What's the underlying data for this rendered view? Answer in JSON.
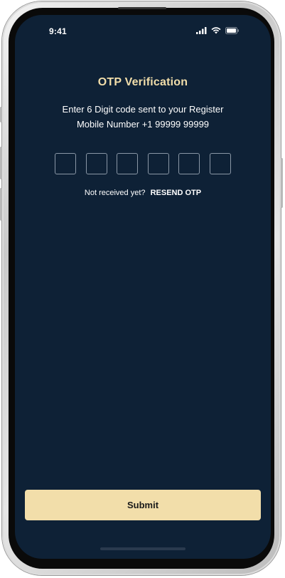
{
  "status_bar": {
    "time": "9:41",
    "icons": [
      "signal-icon",
      "wifi-icon",
      "battery-icon"
    ]
  },
  "otp": {
    "title": "OTP Verification",
    "instruction_line1": "Enter 6 Digit code sent to your Register",
    "instruction_line2": "Mobile Number +1 99999 99999",
    "boxes": [
      "",
      "",
      "",
      "",
      "",
      ""
    ],
    "resend_prompt": "Not received yet?",
    "resend_label": "RESEND OTP"
  },
  "actions": {
    "submit_label": "Submit"
  },
  "colors": {
    "background": "#0e2136",
    "accent": "#f2deaa",
    "box_border": "#8a97a6",
    "text": "#ffffff"
  }
}
